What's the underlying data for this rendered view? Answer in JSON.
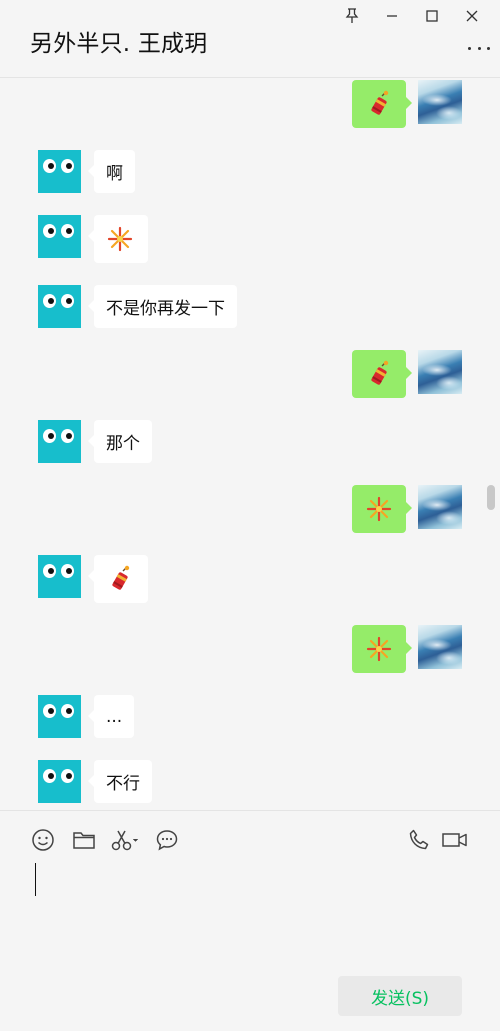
{
  "window": {
    "title": "另外半只. 王成玥"
  },
  "messages": [
    {
      "side": "out",
      "type": "emoji",
      "icon": "firecracker-icon"
    },
    {
      "side": "in",
      "type": "text",
      "text": "啊"
    },
    {
      "side": "in",
      "type": "emoji",
      "icon": "fireworks-icon"
    },
    {
      "side": "in",
      "type": "text",
      "text": "不是你再发一下"
    },
    {
      "side": "out",
      "type": "emoji",
      "icon": "firecracker-icon"
    },
    {
      "side": "in",
      "type": "text",
      "text": "那个"
    },
    {
      "side": "out",
      "type": "emoji",
      "icon": "fireworks-icon"
    },
    {
      "side": "in",
      "type": "emoji",
      "icon": "firecracker-icon"
    },
    {
      "side": "out",
      "type": "emoji",
      "icon": "fireworks-icon"
    },
    {
      "side": "in",
      "type": "text",
      "text": "..."
    },
    {
      "side": "in",
      "type": "text",
      "text": "不行"
    }
  ],
  "composer": {
    "send_label": "发送(S)"
  },
  "colors": {
    "bubble_out": "#95ec69",
    "bubble_in": "#ffffff",
    "avatar_teal": "#17becc",
    "send_text": "#07c160",
    "background": "#f5f5f5"
  }
}
